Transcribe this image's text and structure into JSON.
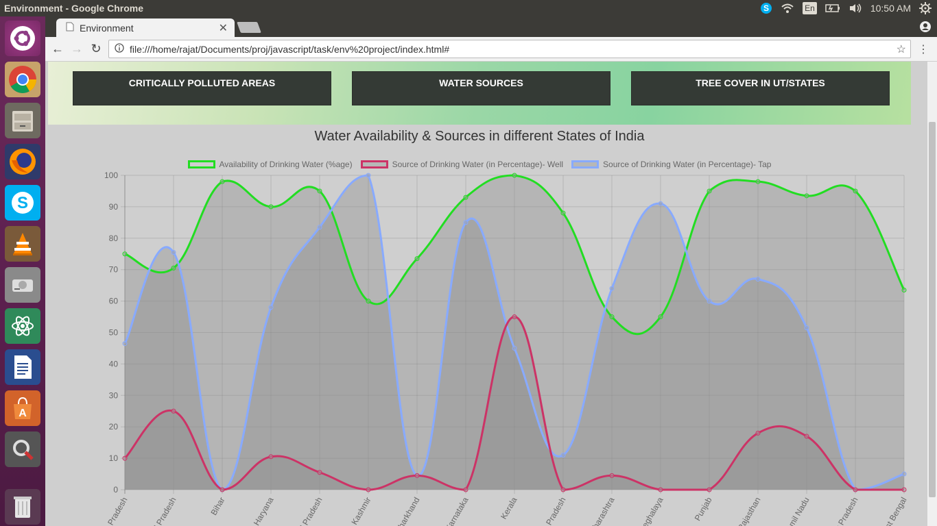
{
  "os": {
    "window_title": "Environment - Google Chrome",
    "clock": "10:50 AM",
    "keyboard_layout": "En"
  },
  "browser": {
    "tab_title": "Environment",
    "url": "file:///home/rajat/Documents/proj/javascript/task/env%20project/index.html#"
  },
  "nav": {
    "buttons": [
      "CRITICALLY POLLUTED AREAS",
      "WATER SOURCES",
      "TREE COVER IN UT/STATES"
    ]
  },
  "chart_data": {
    "type": "area",
    "title": "Water Availability & Sources in different States of India",
    "categories": [
      "Andhra Pradesh",
      "Arunachal Pradesh",
      "Bihar",
      "Haryana",
      "Himachal Pradesh",
      "Jammu & Kashmir",
      "Jharkhand",
      "Karnataka",
      "Kerala",
      "Madhya Pradesh",
      "Maharashtra",
      "Meghalaya",
      "Punjab",
      "Rajasthan",
      "Tamil Nadu",
      "Uttar Pradesh",
      "West Bengal"
    ],
    "tick_labels_visible": [
      "a Pradesh",
      "al Pradesh",
      "Bihar",
      "Haryana",
      "al Pradesh",
      "& Kashmir",
      "Jharkhand",
      "Karnataka",
      "Kerala",
      "a Pradesh",
      "aharashtra",
      "Meghalaya",
      "Punjab",
      "Rajasthan",
      "Tamil Nadu",
      "r Pradesh",
      "est Bengal"
    ],
    "ylim": [
      0,
      100
    ],
    "yticks": [
      0,
      10,
      20,
      30,
      40,
      50,
      60,
      70,
      80,
      90,
      100
    ],
    "grid": true,
    "legend_position": "top",
    "series": [
      {
        "name": "Availability of Drinking Water (%age)",
        "color": "#22dd22",
        "fill": false,
        "values": [
          75,
          70.5,
          98,
          90,
          95,
          60,
          73.5,
          93,
          100,
          88,
          55,
          55,
          95,
          98,
          93.5,
          95,
          63.5
        ]
      },
      {
        "name": "Source of Drinking Water (in Percentage)- Well",
        "color": "#cc3366",
        "fill": true,
        "values": [
          10,
          25,
          0,
          10.5,
          5.5,
          0,
          4.5,
          0,
          55,
          0,
          4.5,
          0,
          0,
          18,
          17,
          0,
          0
        ]
      },
      {
        "name": "Source of Drinking Water (in Percentage)- Tap",
        "color": "#88aaff",
        "fill": true,
        "values": [
          46.5,
          75.5,
          0,
          58,
          83.5,
          100,
          4.5,
          85,
          45,
          11,
          64,
          91,
          60,
          67,
          51.5,
          0,
          5
        ]
      }
    ]
  }
}
